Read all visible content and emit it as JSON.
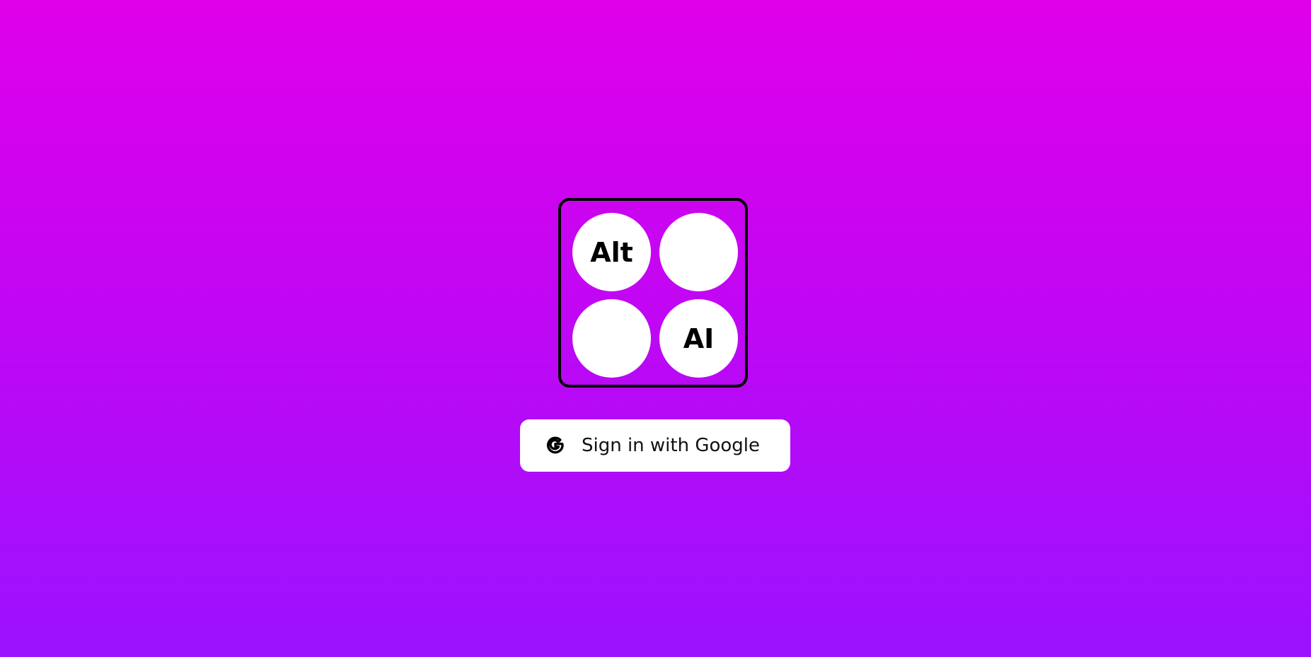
{
  "logo": {
    "circles": [
      {
        "text": "Alt"
      },
      {
        "text": ""
      },
      {
        "text": ""
      },
      {
        "text": "AI"
      }
    ]
  },
  "signin": {
    "label": "Sign in with Google",
    "icon": "google-g-icon"
  },
  "colors": {
    "gradient_top": "#e000ea",
    "gradient_bottom": "#9b12ff",
    "button_bg": "#ffffff",
    "logo_border": "#000000"
  }
}
